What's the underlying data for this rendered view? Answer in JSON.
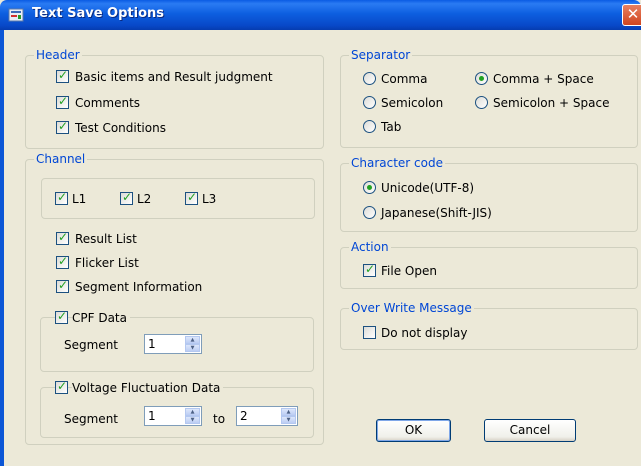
{
  "window": {
    "title": "Text Save Options",
    "close_icon": "close-icon",
    "app_icon": "app-icon"
  },
  "header": {
    "legend": "Header",
    "items": [
      {
        "label": "Basic items and Result judgment",
        "checked": true
      },
      {
        "label": "Comments",
        "checked": true
      },
      {
        "label": "Test Conditions",
        "checked": true
      }
    ]
  },
  "channel": {
    "legend": "Channel",
    "channels": [
      {
        "label": "L1",
        "checked": true
      },
      {
        "label": "L2",
        "checked": true
      },
      {
        "label": "L3",
        "checked": true
      }
    ],
    "lists": [
      {
        "label": "Result List",
        "checked": true
      },
      {
        "label": "Flicker List",
        "checked": true
      },
      {
        "label": "Segment Information",
        "checked": true
      }
    ],
    "cpf": {
      "label": "CPF Data",
      "checked": true,
      "segment_label": "Segment",
      "segment_value": "1"
    },
    "vfd": {
      "label": "Voltage Fluctuation Data",
      "checked": true,
      "segment_label": "Segment",
      "from_value": "1",
      "to_label": "to",
      "to_value": "2"
    }
  },
  "separator": {
    "legend": "Separator",
    "options": [
      {
        "label": "Comma",
        "selected": false
      },
      {
        "label": "Comma + Space",
        "selected": true
      },
      {
        "label": "Semicolon",
        "selected": false
      },
      {
        "label": "Semicolon + Space",
        "selected": false
      },
      {
        "label": "Tab",
        "selected": false
      }
    ]
  },
  "charcode": {
    "legend": "Character code",
    "options": [
      {
        "label": "Unicode(UTF-8)",
        "selected": true
      },
      {
        "label": "Japanese(Shift-JIS)",
        "selected": false
      }
    ]
  },
  "action": {
    "legend": "Action",
    "file_open": {
      "label": "File Open",
      "checked": true
    }
  },
  "overwrite": {
    "legend": "Over Write Message",
    "do_not_display": {
      "label": "Do not display",
      "checked": false
    }
  },
  "buttons": {
    "ok": "OK",
    "cancel": "Cancel"
  }
}
